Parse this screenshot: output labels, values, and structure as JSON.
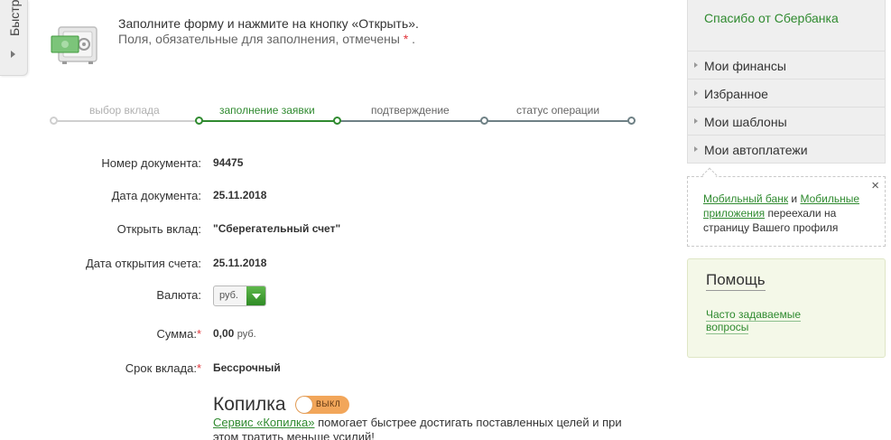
{
  "quick_tab": {
    "label": "Быстр"
  },
  "intro": {
    "line1": "Заполните форму и нажмите на кнопку «Открыть».",
    "line2": "Поля, обязательные для заполнения, отмечены",
    "required_mark": "*",
    "line2_end": "."
  },
  "steps": [
    {
      "label": "выбор вклада",
      "state": "done"
    },
    {
      "label": "заполнение заявки",
      "state": "active"
    },
    {
      "label": "подтверждение",
      "state": "pending"
    },
    {
      "label": "статус операции",
      "state": "pending"
    }
  ],
  "form": {
    "doc_number_label": "Номер документа:",
    "doc_number": "94475",
    "doc_date_label": "Дата документа:",
    "doc_date": "25.11.2018",
    "deposit_label": "Открыть вклад:",
    "deposit": "\"Сберегательный счет\"",
    "open_date_label": "Дата открытия счета:",
    "open_date": "25.11.2018",
    "currency_label": "Валюта:",
    "currency": "руб.",
    "amount_label": "Сумма:",
    "amount": "0,00",
    "amount_unit": "руб.",
    "term_label": "Срок вклада:",
    "term": "Бессрочный",
    "required_mark": "*"
  },
  "kopilka": {
    "title": "Копилка",
    "toggle_state": "ВЫКЛ",
    "link": "Сервис «Копилка»",
    "desc": "помогает быстрее достигать поставленных целей и при этом тратить меньше усилий!"
  },
  "sidebar": {
    "thanks": "Спасибо от Сбербанка",
    "menu": [
      {
        "label": "Мои финансы"
      },
      {
        "label": "Избранное"
      },
      {
        "label": "Мои шаблоны"
      },
      {
        "label": "Мои автоплатежи"
      }
    ],
    "notice": {
      "link1": "Мобильный банк",
      "and": "и",
      "link2": "Мобильные приложения",
      "text": "переехали на страницу Вашего профиля",
      "close": "×"
    },
    "help": {
      "title": "Помощь",
      "faq": "Часто задаваемые вопросы"
    }
  },
  "colors": {
    "accent": "#2f8a2f",
    "step_done": "#cfcfcf",
    "step_pending": "#6e8085",
    "required": "#e1353b",
    "toggle": "#f2a65a"
  }
}
